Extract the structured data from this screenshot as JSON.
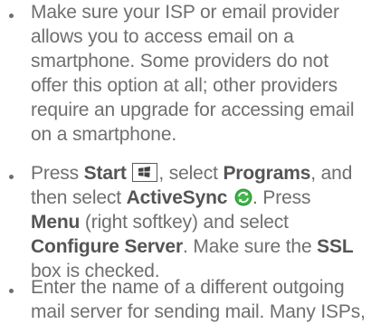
{
  "items": [
    {
      "lines": [
        "Make sure your ISP or email provider",
        "allows you to access email on a",
        "smartphone. Some providers do not",
        "offer this option at all; other providers",
        "require an upgrade for accessing email",
        "on a smartphone."
      ]
    },
    {
      "l1_a": "Press ",
      "l1_start": "Start",
      "l1_b": ", select ",
      "l1_programs": "Programs",
      "l1_c": ", and",
      "l2_a": "then select ",
      "l2_activesync": "ActiveSync",
      "l2_b": ". Press",
      "l3_menu": "Menu",
      "l3_a": " (right softkey) and select",
      "l4_configure": "Configure Server",
      "l4_a": ". Make sure the ",
      "l4_ssl": "SSL",
      "l5_a": "box is checked."
    },
    {
      "lines": [
        "Enter the name of a different outgoing",
        "mail server for sending mail. Many ISPs,"
      ]
    }
  ],
  "icons": {
    "start": "windows-start-key-icon",
    "activesync": "activesync-icon"
  },
  "colors": {
    "text": "#6f6f6f",
    "bold": "#555555",
    "sync_green": "#2e9a3a"
  }
}
